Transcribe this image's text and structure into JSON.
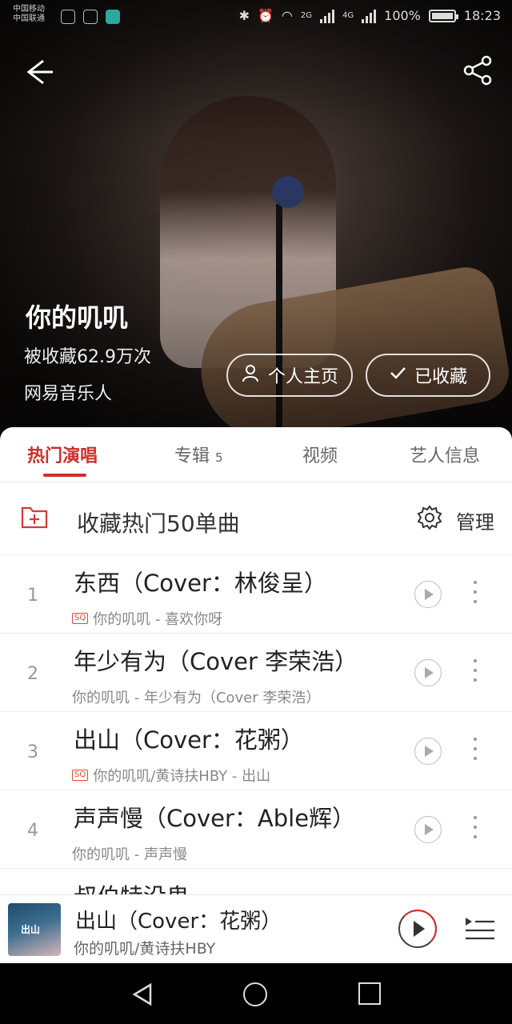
{
  "status_bar": {
    "carrier_line1": "中国移动",
    "carrier_line2": "中国联通",
    "net1": "2G",
    "net2": "4G",
    "battery": "100%",
    "time": "18:23"
  },
  "artist": {
    "name": "你的叽叽",
    "favorites": "被收藏62.9万次",
    "source": "网易音乐人",
    "home_button": "个人主页",
    "collected_button": "已收藏"
  },
  "tabs": [
    {
      "label": "热门演唱"
    },
    {
      "label": "专辑",
      "count": "5"
    },
    {
      "label": "视频"
    },
    {
      "label": "艺人信息"
    }
  ],
  "collect_row": {
    "label": "收藏热门50单曲",
    "manage": "管理"
  },
  "songs": [
    {
      "index": "1",
      "title": "东西（Cover：林俊呈）",
      "badge": "SQ",
      "subtitle": "你的叽叽 - 喜欢你呀"
    },
    {
      "index": "2",
      "title": "年少有为（Cover 李荣浩）",
      "badge": "",
      "subtitle": "你的叽叽 - 年少有为（Cover 李荣浩）"
    },
    {
      "index": "3",
      "title": "出山（Cover：花粥）",
      "badge": "SQ",
      "subtitle": "你的叽叽/黄诗扶HBY - 出山"
    },
    {
      "index": "4",
      "title": "声声慢（Cover：Able辉）",
      "badge": "",
      "subtitle": "你的叽叽 - 声声慢"
    },
    {
      "index": "",
      "title": "叔伯特没鬼",
      "badge": "",
      "subtitle": ""
    }
  ],
  "now_playing": {
    "cover_text": "出山",
    "title": "出山（Cover：花粥）",
    "artist": "你的叽叽/黄诗扶HBY"
  },
  "icons": {
    "back": "arrow-left-icon",
    "share": "share-icon",
    "person": "person-icon",
    "check": "check-icon",
    "folder": "folder-plus-icon",
    "gear": "gear-icon",
    "play": "play-icon",
    "more": "more-vertical-icon",
    "playlist": "playlist-icon"
  },
  "colors": {
    "accent": "#c8302b"
  }
}
